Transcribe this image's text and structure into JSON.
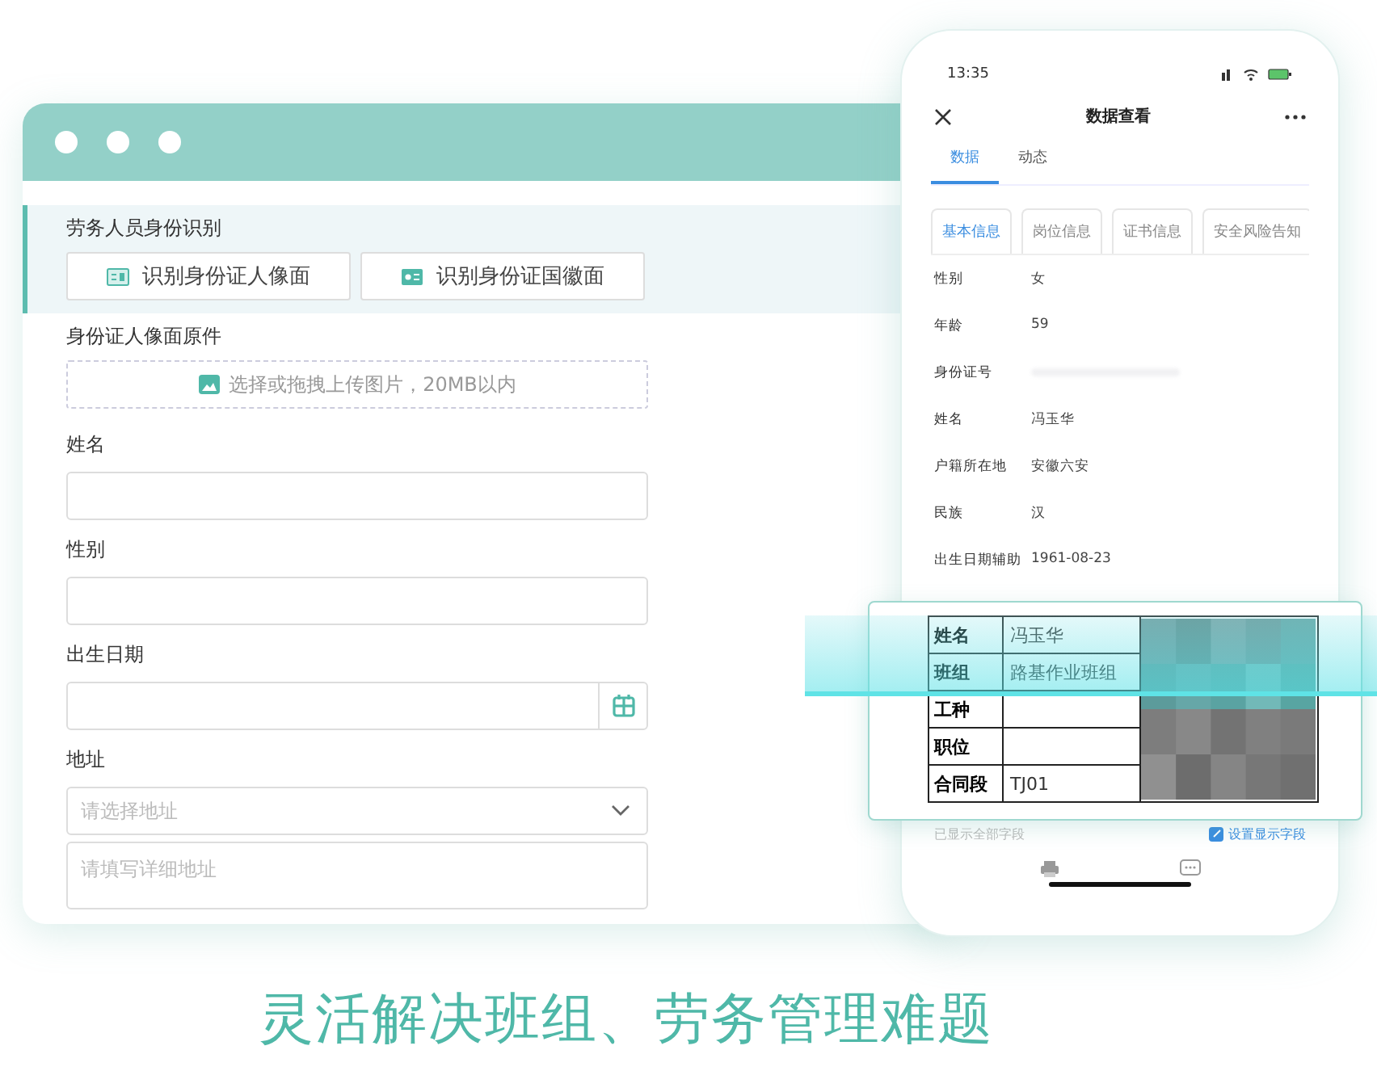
{
  "web_form": {
    "id_section": {
      "title": "劳务人员身份识别",
      "buttons": [
        {
          "label": "识别身份证人像面",
          "kind": "portrait"
        },
        {
          "label": "识别身份证国徽面",
          "kind": "emblem"
        }
      ]
    },
    "upload": {
      "label": "身份证人像面原件",
      "hint": "选择或拖拽上传图片，20MB以内"
    },
    "fields": [
      {
        "label": "姓名",
        "kind": "text"
      },
      {
        "label": "性别",
        "kind": "text"
      },
      {
        "label": "出生日期",
        "kind": "date"
      },
      {
        "label": "地址",
        "kind": "address",
        "placeholder": "请选择地址",
        "detail_placeholder": "请填写详细地址"
      }
    ]
  },
  "phone": {
    "time": "13:35",
    "title": "数据查看",
    "tabs": [
      {
        "label": "数据",
        "selected": true
      },
      {
        "label": "动态",
        "selected": false
      }
    ],
    "sub_tabs": [
      {
        "label": "基本信息",
        "selected": true
      },
      {
        "label": "岗位信息",
        "selected": false
      },
      {
        "label": "证书信息",
        "selected": false
      },
      {
        "label": "安全风险告知",
        "selected": false
      }
    ],
    "rows": [
      {
        "label": "性别",
        "value": "女"
      },
      {
        "label": "年龄",
        "value": "59"
      },
      {
        "label": "身份证号",
        "kind": "blurred"
      },
      {
        "label": "姓名",
        "value": "冯玉华"
      },
      {
        "label": "户籍所在地",
        "value": "安徽六安"
      },
      {
        "label": "民族",
        "value": "汉"
      },
      {
        "label": "出生日期辅助",
        "value": "1961-08-23"
      }
    ],
    "footer_note": "已显示全部字段",
    "footer_link": "设置显示字段"
  },
  "scanned_card": {
    "rows": [
      {
        "label": "姓名",
        "value": "冯玉华"
      },
      {
        "label": "班组",
        "value": "路基作业班组"
      },
      {
        "label": "工种"
      },
      {
        "label": "职位"
      },
      {
        "label": "合同段",
        "value": "TJ01"
      }
    ]
  },
  "caption": "灵活解决班组、劳务管理难题"
}
